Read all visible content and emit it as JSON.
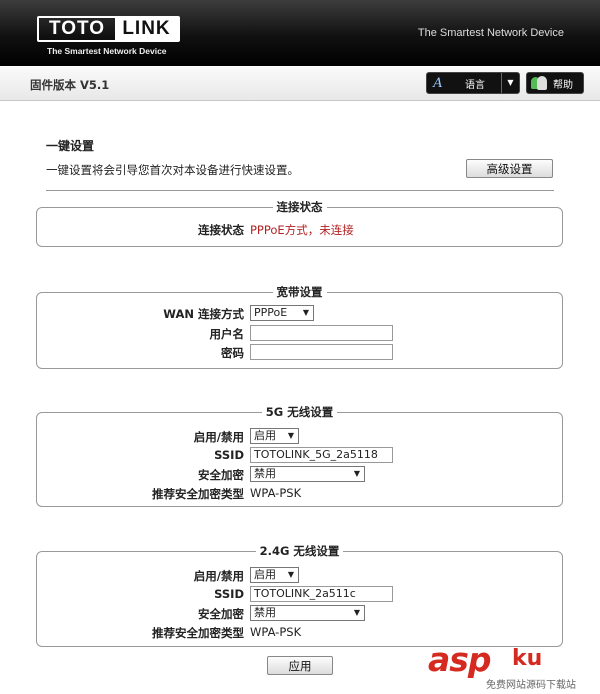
{
  "header": {
    "logo_left": "TOTO",
    "logo_right": "LINK",
    "logo_sub": "The Smartest Network Device",
    "tagline": "The Smartest Network Device"
  },
  "toolbar": {
    "firmware": "固件版本 V5.1",
    "lang_icon": "A",
    "lang_label": "语言",
    "lang_arrow": "▼",
    "help_label": "帮助"
  },
  "main": {
    "title": "一键设置",
    "description": "一键设置将会引导您首次对本设备进行快速设置。",
    "advanced_button": "高级设置"
  },
  "conn_status": {
    "legend": "连接状态",
    "label": "连接状态",
    "value": "PPPoE方式，未连接",
    "value_color": "#b22222"
  },
  "broadband": {
    "legend": "宽带设置",
    "wan_label": "WAN 连接方式",
    "wan_value": "PPPoE",
    "username_label": "用户名",
    "username_value": "",
    "password_label": "密码",
    "password_value": ""
  },
  "wifi5g": {
    "legend": "5G 无线设置",
    "enable_label": "启用/禁用",
    "enable_value": "启用",
    "ssid_label": "SSID",
    "ssid_value": "TOTOLINK_5G_2a5118",
    "security_label": "安全加密",
    "security_value": "禁用",
    "recommend_label": "推荐安全加密类型",
    "recommend_value": "WPA-PSK"
  },
  "wifi24g": {
    "legend": "2.4G 无线设置",
    "enable_label": "启用/禁用",
    "enable_value": "启用",
    "ssid_label": "SSID",
    "ssid_value": "TOTOLINK_2a511c",
    "security_label": "安全加密",
    "security_value": "禁用",
    "recommend_label": "推荐安全加密类型",
    "recommend_value": "WPA-PSK"
  },
  "footer": {
    "apply_button": "应用"
  },
  "watermark": {
    "brand": "asp",
    "brand_cn": "ku",
    "sub": "免费网站源码下载站"
  },
  "icons": {
    "dropdown": "▼"
  }
}
